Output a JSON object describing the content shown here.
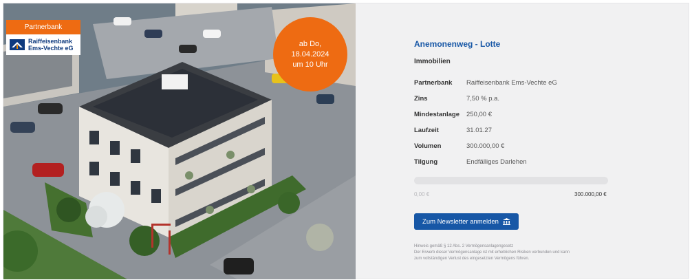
{
  "media": {
    "partner_tag": "Partnerbank",
    "bank_logo_text": "Raiffeisenbank\nEms-Vechte eG",
    "badge_lines": [
      "ab Do,",
      "18.04.2024",
      "um 10 Uhr"
    ]
  },
  "colors": {
    "accent_orange": "#ee6b12",
    "primary_blue": "#1757a6",
    "panel_background": "#f1f1f2"
  },
  "project": {
    "title": "Anemonenweg - Lotte",
    "category": "Immobilien",
    "facts": [
      {
        "label": "Partnerbank",
        "value": "Raiffeisenbank Ems-Vechte eG"
      },
      {
        "label": "Zins",
        "value": "7,50 % p.a."
      },
      {
        "label": "Mindestanlage",
        "value": "250,00 €"
      },
      {
        "label": "Laufzeit",
        "value": "31.01.27"
      },
      {
        "label": "Volumen",
        "value": "300.000,00 €"
      },
      {
        "label": "Tilgung",
        "value": "Endfälliges Darlehen"
      }
    ]
  },
  "funding": {
    "raised": "0,00 €",
    "target": "300.000,00 €",
    "progress_fraction": 0
  },
  "newsletter": {
    "label": "Zum Newsletter anmelden",
    "icon": "bank-building-icon"
  },
  "notice": {
    "lines": [
      "Hinweis gemäß § 12 Abs. 2 Vermögensanlagengesetz",
      "Der Erwerb dieser Vermögensanlage ist mit erheblichen Risiken verbunden und kann",
      "zum vollständigen Verlust des eingesetzten Vermögens führen."
    ]
  }
}
